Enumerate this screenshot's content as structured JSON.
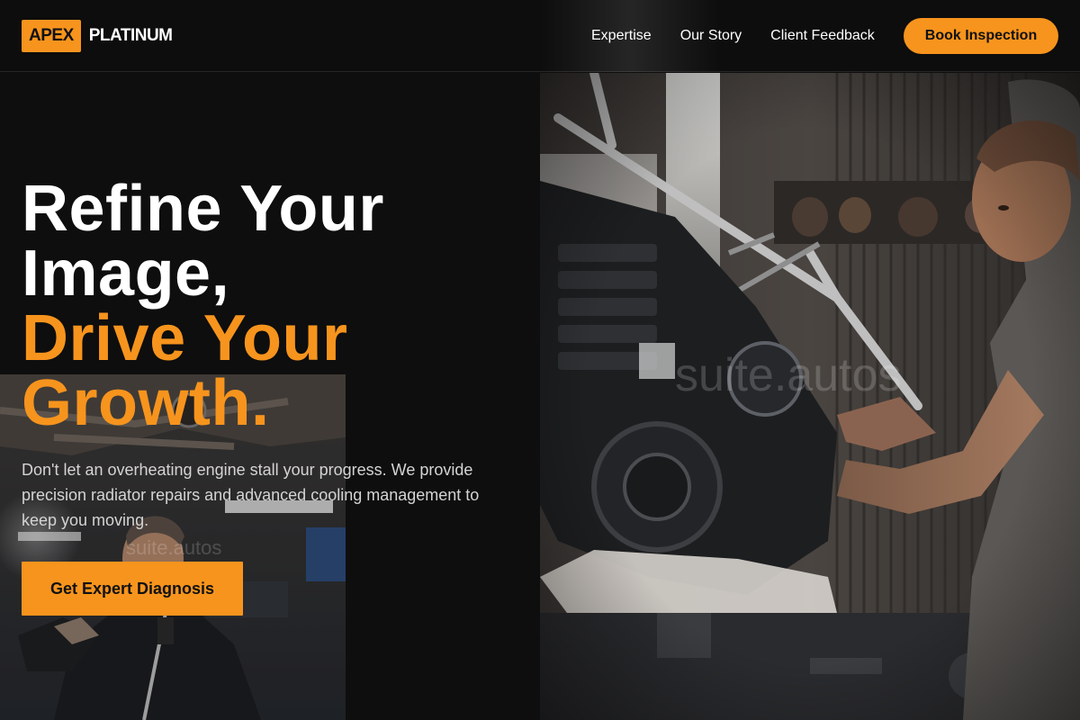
{
  "brand": {
    "badge": "APEX",
    "name": "PLATINUM",
    "accent_color": "#f7941d"
  },
  "nav": {
    "links": [
      "Expertise",
      "Our Story",
      "Client Feedback"
    ],
    "cta": "Book Inspection"
  },
  "hero": {
    "title_line1": "Refine Your",
    "title_line2": "Image,",
    "title_accent_line1": "Drive Your",
    "title_accent_line2": "Growth.",
    "description": "Don't let an overheating engine stall your progress. We provide precision radiator repairs and advanced cooling management to keep you moving.",
    "cta": "Get Expert Diagnosis"
  },
  "images": {
    "right_watermark": "suite.autos",
    "left_watermark": "suite.autos"
  }
}
